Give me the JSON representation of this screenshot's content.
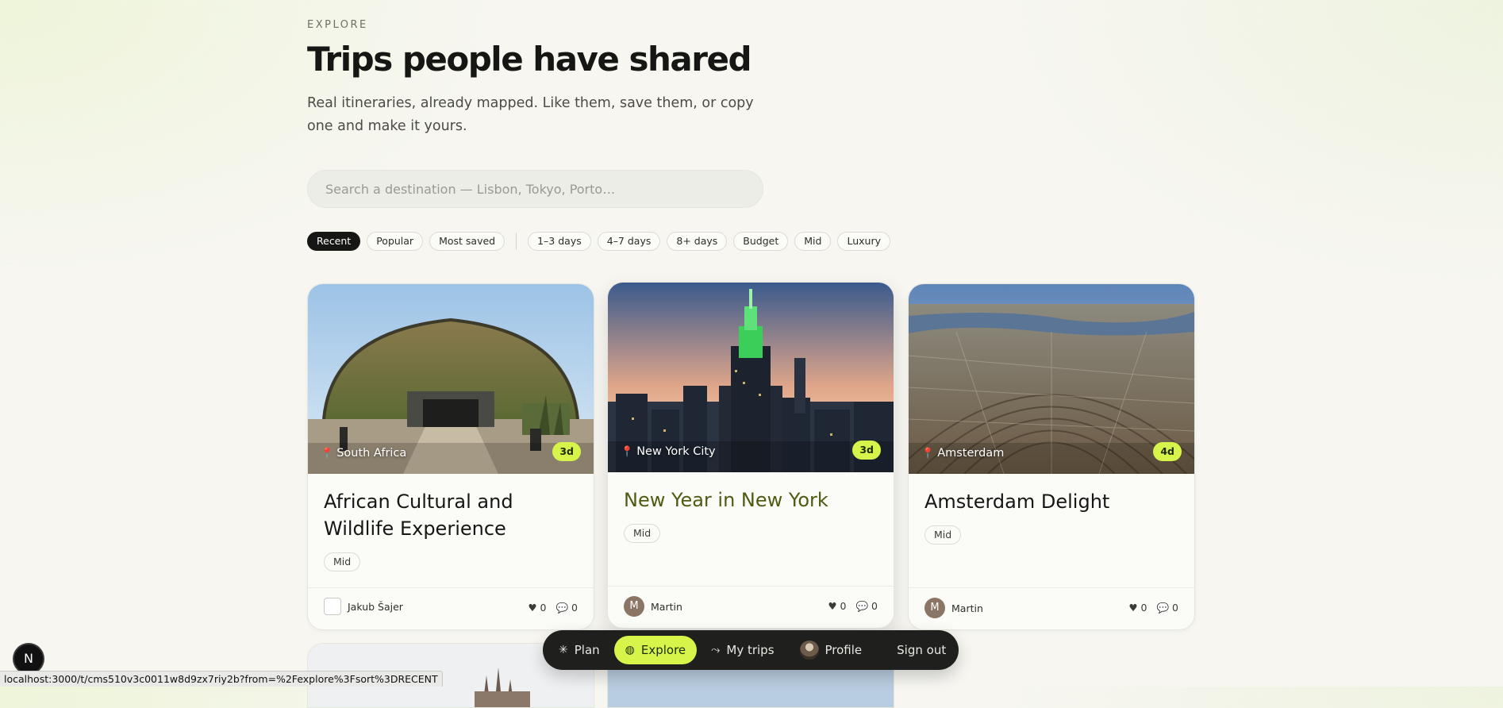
{
  "header": {
    "eyebrow": "EXPLORE",
    "title": "Trips people have shared",
    "subtitle": "Real itineraries, already mapped. Like them, save them, or copy one and make it yours."
  },
  "search": {
    "placeholder": "Search a destination — Lisbon, Tokyo, Porto…",
    "value": ""
  },
  "filters": {
    "sort": [
      {
        "label": "Recent",
        "active": true
      },
      {
        "label": "Popular",
        "active": false
      },
      {
        "label": "Most saved",
        "active": false
      }
    ],
    "refine": [
      {
        "label": "1–3 days"
      },
      {
        "label": "4–7 days"
      },
      {
        "label": "8+ days"
      },
      {
        "label": "Budget"
      },
      {
        "label": "Mid"
      },
      {
        "label": "Luxury"
      }
    ]
  },
  "cards": [
    {
      "location": "South Africa",
      "days": "3d",
      "title": "African Cultural and Wildlife Experience",
      "tier": "Mid",
      "author": "Jakub Šajer",
      "likes": "0",
      "comments": "0"
    },
    {
      "location": "New York City",
      "days": "3d",
      "title": "New Year in New York",
      "tier": "Mid",
      "author": "Martin",
      "author_initial": "M",
      "likes": "0",
      "comments": "0"
    },
    {
      "location": "Amsterdam",
      "days": "4d",
      "title": "Amsterdam Delight",
      "tier": "Mid",
      "author": "Martin",
      "author_initial": "M",
      "likes": "0",
      "comments": "0"
    }
  ],
  "nav": {
    "plan": "Plan",
    "explore": "Explore",
    "my_trips": "My trips",
    "profile": "Profile",
    "sign_out": "Sign out"
  },
  "icons": {
    "pin": "map-pin-icon",
    "heart": "heart-icon",
    "comment": "comment-icon",
    "plan": "sparkle-icon",
    "explore": "globe-icon",
    "my_trips": "route-icon"
  },
  "colors": {
    "accent": "#d7f44a",
    "ink": "#161614",
    "highlight_title": "#4f5a12"
  },
  "status_bar": "localhost:3000/t/cms510v3c0011w8d9zx7riy2b?from=%2Fexplore%3Fsort%3DRECENT",
  "dev_badge": "N"
}
